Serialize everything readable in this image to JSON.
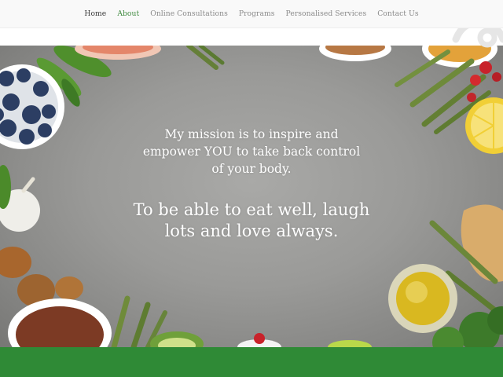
{
  "nav": {
    "items": [
      {
        "label": "Home"
      },
      {
        "label": "About"
      },
      {
        "label": "Online Consultations"
      },
      {
        "label": "Programs"
      },
      {
        "label": "Personalised Services"
      },
      {
        "label": "Contact Us"
      }
    ],
    "active_index": 1
  },
  "hero": {
    "mission_lines": [
      "My mission is to inspire and",
      "empower YOU to take back control",
      "of your body."
    ],
    "tagline_lines": [
      "To be able to eat well, laugh",
      "lots and love always."
    ]
  },
  "colors": {
    "nav_active": "#3f8a3f",
    "band_green": "#2f8a36",
    "hero_gray": "#9a9a98"
  },
  "icons": [
    "logo-mark-icon"
  ]
}
